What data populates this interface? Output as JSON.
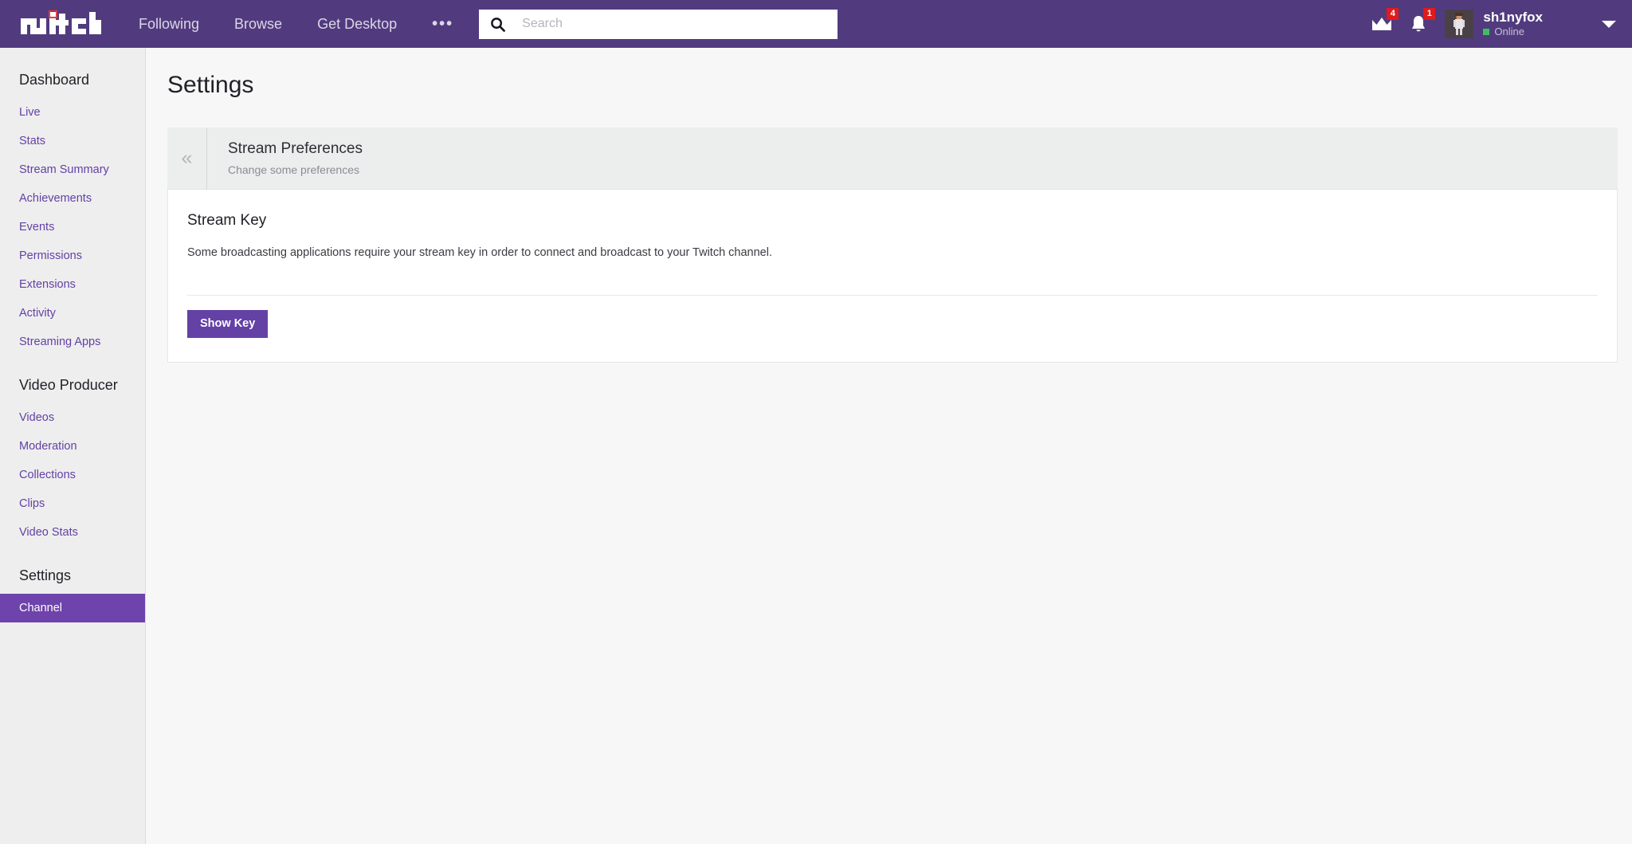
{
  "topnav": {
    "logo_alt": "twitch-logo",
    "links": [
      {
        "label": "Following"
      },
      {
        "label": "Browse"
      },
      {
        "label": "Get Desktop"
      }
    ],
    "more_label": "•••",
    "search": {
      "placeholder": "Search",
      "value": ""
    },
    "whispers": {
      "icon": "crown-icon",
      "badge": "4"
    },
    "notifications": {
      "icon": "bell-icon",
      "badge": "1"
    },
    "user": {
      "name": "sh1nyfox",
      "status": "Online",
      "status_color": "#3fbf5f"
    }
  },
  "sidebar": {
    "sections": [
      {
        "heading": "Dashboard",
        "items": [
          {
            "label": "Live",
            "active": false
          },
          {
            "label": "Stats",
            "active": false
          },
          {
            "label": "Stream Summary",
            "active": false
          },
          {
            "label": "Achievements",
            "active": false
          },
          {
            "label": "Events",
            "active": false
          },
          {
            "label": "Permissions",
            "active": false
          },
          {
            "label": "Extensions",
            "active": false
          },
          {
            "label": "Activity",
            "active": false
          },
          {
            "label": "Streaming Apps",
            "active": false
          }
        ]
      },
      {
        "heading": "Video Producer",
        "items": [
          {
            "label": "Videos",
            "active": false
          },
          {
            "label": "Moderation",
            "active": false
          },
          {
            "label": "Collections",
            "active": false
          },
          {
            "label": "Clips",
            "active": false
          },
          {
            "label": "Video Stats",
            "active": false
          }
        ]
      },
      {
        "heading": "Settings",
        "items": [
          {
            "label": "Channel",
            "active": true
          }
        ]
      }
    ]
  },
  "main": {
    "page_title": "Settings",
    "panel": {
      "collapse_glyph": "«",
      "title": "Stream Preferences",
      "subtitle": "Change some preferences"
    },
    "card": {
      "title": "Stream Key",
      "description": "Some broadcasting applications require your stream key in order to connect and broadcast to your Twitch channel.",
      "button_label": "Show Key"
    }
  },
  "colors": {
    "brand_purple": "#6441a5",
    "header_purple": "#513b7e",
    "active_purple": "#6e43ab",
    "badge_red": "#e01b1b",
    "online_green": "#3fbf5f"
  }
}
